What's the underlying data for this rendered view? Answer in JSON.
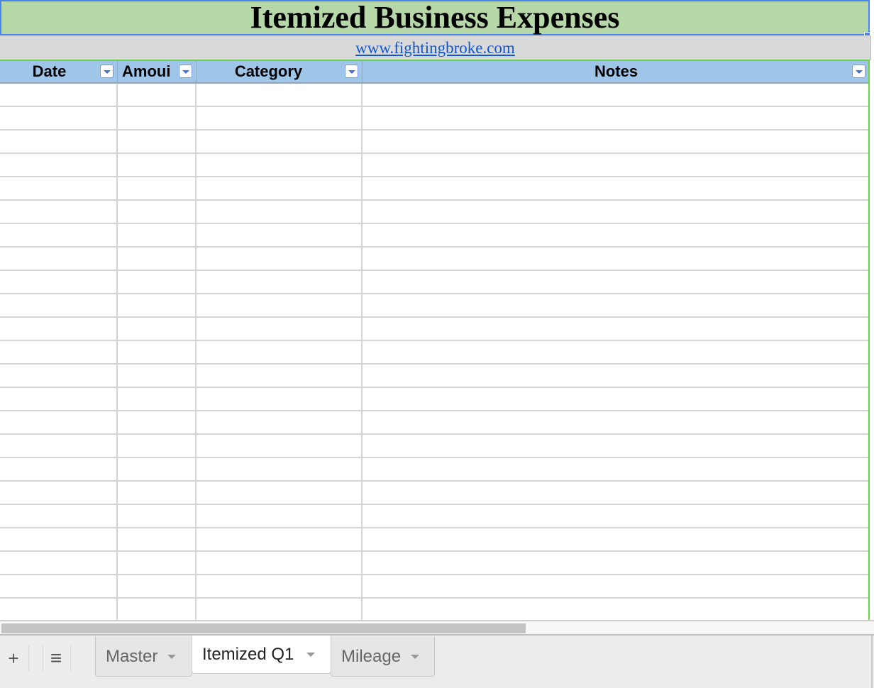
{
  "sheet": {
    "title": "Itemized Business Expenses",
    "link_text": "www.fightingbroke.com",
    "columns": [
      {
        "label": "Date",
        "filter_icon": "filter-dropdown-icon"
      },
      {
        "label": "Amoui",
        "filter_icon": "filter-dropdown-icon"
      },
      {
        "label": "Category",
        "filter_icon": "filter-dropdown-icon"
      },
      {
        "label": "Notes",
        "filter_icon": "filter-dropdown-icon"
      }
    ],
    "row_count": 23,
    "rows": []
  },
  "tabbar": {
    "add_icon": "+",
    "list_icon": "≡",
    "tabs": [
      {
        "label": "Master",
        "active": false
      },
      {
        "label": "Itemized Q1",
        "active": true
      },
      {
        "label": "Mileage",
        "active": false
      }
    ]
  },
  "colors": {
    "title_bg": "#b6d7a8",
    "header_bg": "#9fc5e8",
    "link_row_bg": "#d9d9d9",
    "selection": "#4a86e8",
    "link": "#1155cc"
  }
}
